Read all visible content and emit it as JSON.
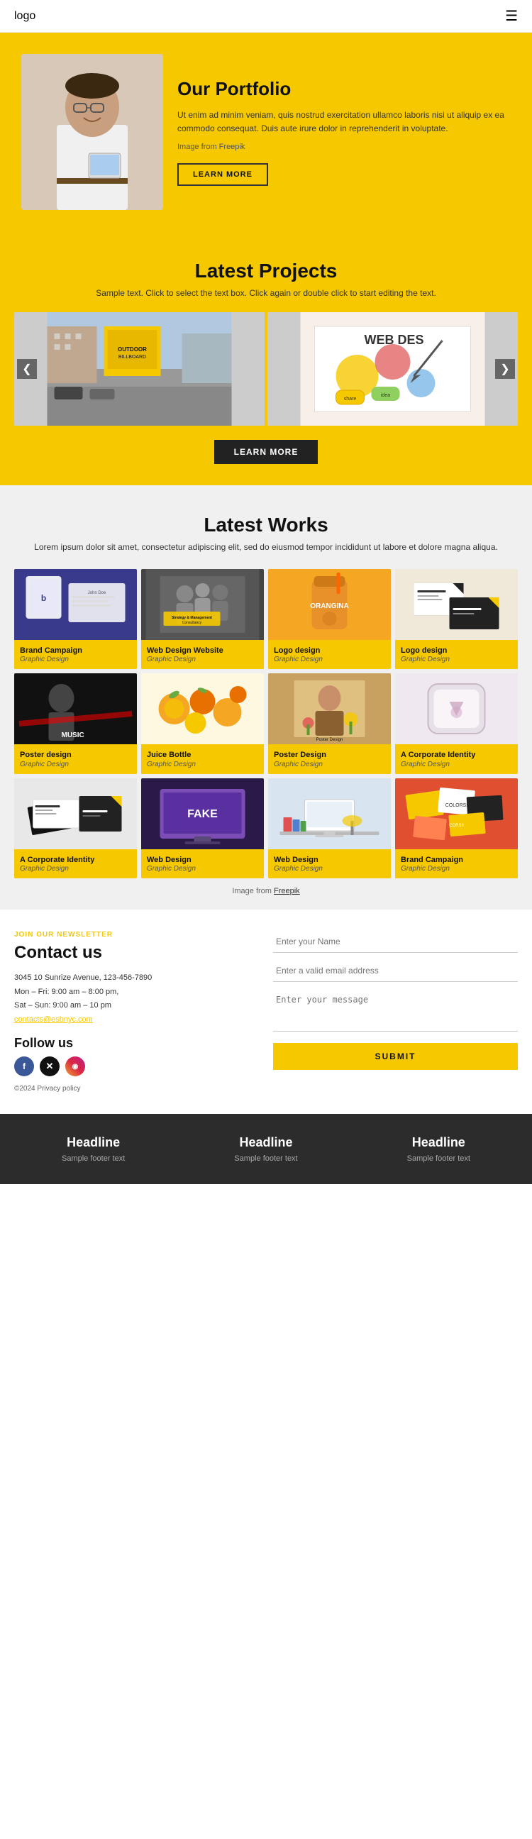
{
  "header": {
    "logo": "logo",
    "menu_icon": "☰"
  },
  "hero": {
    "title": "Our Portfolio",
    "description": "Ut enim ad minim veniam, quis nostrud exercitation ullamco laboris nisi ut aliquip ex ea commodo consequat. Duis aute irure dolor in reprehenderit in voluptate.",
    "image_credit": "Image from Freepik",
    "freepik_link": "Freepik",
    "btn_label": "LEARN MORE"
  },
  "latest_projects": {
    "title": "Latest Projects",
    "subtitle": "Sample text. Click to select the text box. Click again or double click to start editing the text.",
    "btn_label": "LEARN MORE",
    "arrow_left": "❮",
    "arrow_right": "❯"
  },
  "latest_works": {
    "title": "Latest Works",
    "description": "Lorem ipsum dolor sit amet, consectetur adipiscing elit, sed do eiusmod tempor incididunt ut labore et dolore magna aliqua.",
    "image_credit": "Image from Freepik",
    "freepik_link": "Freepik",
    "items": [
      {
        "title": "Brand Campaign",
        "category": "Graphic Design",
        "bg": "#3a3a8c"
      },
      {
        "title": "Web Design Website",
        "category": "Graphic Design",
        "bg": "#555"
      },
      {
        "title": "Logo design",
        "category": "Graphic Design",
        "bg": "#f5a623"
      },
      {
        "title": "Logo design",
        "category": "Graphic Design",
        "bg": "#222"
      },
      {
        "title": "Poster design",
        "category": "Graphic Design",
        "bg": "#111"
      },
      {
        "title": "Juice Bottle",
        "category": "Graphic Design",
        "bg": "#f5a623"
      },
      {
        "title": "Poster Design",
        "category": "Graphic Design",
        "bg": "#c8a060"
      },
      {
        "title": "A Corporate Identity",
        "category": "Graphic Design",
        "bg": "#f0c8d0"
      },
      {
        "title": "A Corporate Identity",
        "category": "Graphic Design",
        "bg": "#e0e0e0"
      },
      {
        "title": "Web Design",
        "category": "Graphic Design",
        "bg": "#7c4db5"
      },
      {
        "title": "Web Design",
        "category": "Graphic Design",
        "bg": "#d0d8e8"
      },
      {
        "title": "Brand Campaign",
        "category": "Graphic Design",
        "bg": "#e05030"
      }
    ]
  },
  "contact": {
    "newsletter_label": "JOIN OUR NEWSLETTER",
    "title": "Contact us",
    "address_line1": "3045 10 Sunrize Avenue, 123-456-7890",
    "address_line2": "Mon – Fri: 9:00 am – 8:00 pm,",
    "address_line3": "Sat – Sun: 9:00 am – 10 pm",
    "email": "contacts@esbnyc.com",
    "follow_title": "Follow us",
    "social": [
      "f",
      "✕",
      "◉"
    ],
    "copyright": "©2024 Privacy policy",
    "form": {
      "name_placeholder": "Enter your Name",
      "email_placeholder": "Enter a valid email address",
      "message_placeholder": "Enter your message",
      "submit_label": "SUBMIT"
    }
  },
  "footer": {
    "columns": [
      {
        "headline": "Headline",
        "text": "Sample footer text"
      },
      {
        "headline": "Headline",
        "text": "Sample footer text"
      },
      {
        "headline": "Headline",
        "text": "Sample footer text"
      }
    ]
  }
}
